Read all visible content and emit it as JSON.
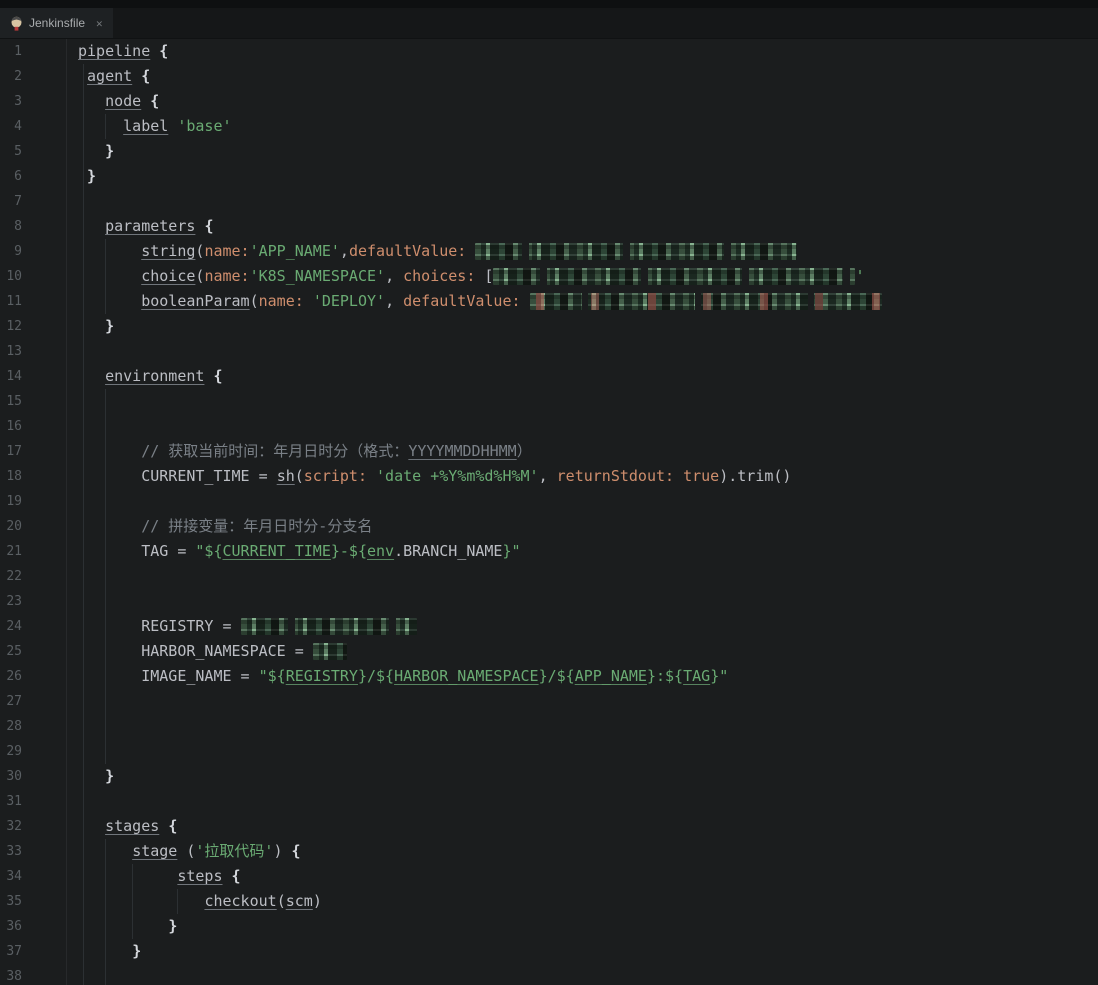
{
  "tab": {
    "title": "Jenkinsfile",
    "close": "✕",
    "icon": "jenkins-icon"
  },
  "theme": {
    "background": "#1b1d1e",
    "string_green": "#6aab73",
    "named_arg_orange": "#cf8e6d",
    "comment_gray": "#7a8087",
    "default_text": "#bcbec4",
    "line_number": "#5a5f63"
  },
  "editor": {
    "language": "Jenkinsfile (Groovy pipeline)",
    "lines": [
      {
        "n": "1",
        "ind": 0,
        "t": [
          [
            "pipeline",
            "u"
          ],
          [
            " ",
            "d"
          ],
          [
            "{",
            "b"
          ]
        ]
      },
      {
        "n": "2",
        "ind": 1,
        "t": [
          [
            "agent",
            "u"
          ],
          [
            " ",
            "d"
          ],
          [
            "{",
            "b"
          ]
        ]
      },
      {
        "n": "3",
        "ind": 3,
        "t": [
          [
            "node",
            "u"
          ],
          [
            " ",
            "d"
          ],
          [
            "{",
            "b"
          ]
        ]
      },
      {
        "n": "4",
        "ind": 5,
        "t": [
          [
            "label",
            "u"
          ],
          [
            " ",
            "d"
          ],
          [
            "'base'",
            "s"
          ]
        ]
      },
      {
        "n": "5",
        "ind": 3,
        "t": [
          [
            "}",
            "b"
          ]
        ]
      },
      {
        "n": "6",
        "ind": 1,
        "t": [
          [
            "}",
            "b"
          ]
        ]
      },
      {
        "n": "7",
        "ind": 0,
        "t": []
      },
      {
        "n": "8",
        "ind": 3,
        "t": [
          [
            "parameters",
            "u"
          ],
          [
            " ",
            "d"
          ],
          [
            "{",
            "b"
          ]
        ]
      },
      {
        "n": "9",
        "ind": 7,
        "t": [
          [
            "string",
            "u"
          ],
          [
            "(",
            "d"
          ],
          [
            "name:",
            "o"
          ],
          [
            "'APP_NAME'",
            "s"
          ],
          [
            ",",
            "d"
          ],
          [
            "defaultValue:",
            "o"
          ],
          [
            " ",
            "d"
          ],
          [
            "",
            "r",
            322
          ]
        ]
      },
      {
        "n": "10",
        "ind": 7,
        "t": [
          [
            "choice",
            "u"
          ],
          [
            "(",
            "d"
          ],
          [
            "name:",
            "o"
          ],
          [
            "'K8S_NAMESPACE'",
            "s"
          ],
          [
            ", ",
            "d"
          ],
          [
            "choices:",
            "o"
          ],
          [
            " [",
            "d"
          ],
          [
            "",
            "r",
            362
          ],
          [
            "'",
            "s"
          ]
        ]
      },
      {
        "n": "11",
        "ind": 7,
        "t": [
          [
            "booleanParam",
            "u"
          ],
          [
            "(",
            "d"
          ],
          [
            "name:",
            "o"
          ],
          [
            " ",
            "d"
          ],
          [
            "'DEPLOY'",
            "s"
          ],
          [
            ", ",
            "d"
          ],
          [
            "defaultValue:",
            "o"
          ],
          [
            " ",
            "d"
          ],
          [
            "",
            "r2",
            352
          ]
        ]
      },
      {
        "n": "12",
        "ind": 3,
        "t": [
          [
            "}",
            "b"
          ]
        ]
      },
      {
        "n": "13",
        "ind": 0,
        "t": []
      },
      {
        "n": "14",
        "ind": 3,
        "t": [
          [
            "environment",
            "u"
          ],
          [
            " ",
            "d"
          ],
          [
            "{",
            "b"
          ]
        ]
      },
      {
        "n": "15",
        "ind": 0,
        "t": []
      },
      {
        "n": "16",
        "ind": 0,
        "t": []
      },
      {
        "n": "17",
        "ind": 7,
        "t": [
          [
            "// 获取当前时间：年月日时分（格式：",
            "c"
          ],
          [
            "YYYYMMDDHHMM",
            "cu"
          ],
          [
            "）",
            "c"
          ]
        ]
      },
      {
        "n": "18",
        "ind": 7,
        "t": [
          [
            "CURRENT_TIME = ",
            "d"
          ],
          [
            "sh",
            "u"
          ],
          [
            "(",
            "d"
          ],
          [
            "script:",
            "o"
          ],
          [
            " ",
            "d"
          ],
          [
            "'date +%Y%m%d%H%M'",
            "s"
          ],
          [
            ", ",
            "d"
          ],
          [
            "returnStdout:",
            "o"
          ],
          [
            " ",
            "d"
          ],
          [
            "true",
            "o"
          ],
          [
            ").trim()",
            "d"
          ]
        ]
      },
      {
        "n": "19",
        "ind": 0,
        "t": []
      },
      {
        "n": "20",
        "ind": 7,
        "t": [
          [
            "// 拼接变量：年月日时分-分支名",
            "c"
          ]
        ]
      },
      {
        "n": "21",
        "ind": 7,
        "t": [
          [
            "TAG = ",
            "d"
          ],
          [
            "\"${",
            "s"
          ],
          [
            "CURRENT_TIME",
            "su"
          ],
          [
            "}-${",
            "s"
          ],
          [
            "env",
            "su"
          ],
          [
            ".BRANCH_NAME",
            "d"
          ],
          [
            "}\"",
            "s"
          ]
        ]
      },
      {
        "n": "22",
        "ind": 0,
        "t": []
      },
      {
        "n": "23",
        "ind": 0,
        "t": []
      },
      {
        "n": "24",
        "ind": 7,
        "t": [
          [
            "REGISTRY = ",
            "d"
          ],
          [
            "",
            "r",
            176
          ]
        ]
      },
      {
        "n": "25",
        "ind": 7,
        "t": [
          [
            "HARBOR_NAMESPACE = ",
            "d"
          ],
          [
            "",
            "r",
            34
          ]
        ]
      },
      {
        "n": "26",
        "ind": 7,
        "t": [
          [
            "IMAGE_NAME = ",
            "d"
          ],
          [
            "\"${",
            "s"
          ],
          [
            "REGISTRY",
            "su"
          ],
          [
            "}/${",
            "s"
          ],
          [
            "HARBOR_NAMESPACE",
            "su"
          ],
          [
            "}/${",
            "s"
          ],
          [
            "APP_NAME",
            "su"
          ],
          [
            "}:${",
            "s"
          ],
          [
            "TAG",
            "su"
          ],
          [
            "}\"",
            "s"
          ]
        ]
      },
      {
        "n": "27",
        "ind": 0,
        "t": []
      },
      {
        "n": "28",
        "ind": 0,
        "t": []
      },
      {
        "n": "29",
        "ind": 0,
        "t": []
      },
      {
        "n": "30",
        "ind": 3,
        "t": [
          [
            "}",
            "b"
          ]
        ]
      },
      {
        "n": "31",
        "ind": 0,
        "t": []
      },
      {
        "n": "32",
        "ind": 3,
        "t": [
          [
            "stages",
            "u"
          ],
          [
            " ",
            "d"
          ],
          [
            "{",
            "b"
          ]
        ]
      },
      {
        "n": "33",
        "ind": 6,
        "t": [
          [
            "stage",
            "u"
          ],
          [
            " (",
            "d"
          ],
          [
            "'拉取代码'",
            "s"
          ],
          [
            ") ",
            "d"
          ],
          [
            "{",
            "b"
          ]
        ]
      },
      {
        "n": "34",
        "ind": 11,
        "t": [
          [
            "steps",
            "u"
          ],
          [
            " ",
            "d"
          ],
          [
            "{",
            "b"
          ]
        ]
      },
      {
        "n": "35",
        "ind": 14,
        "t": [
          [
            "checkout",
            "u"
          ],
          [
            "(",
            "d"
          ],
          [
            "scm",
            "u"
          ],
          [
            ")",
            "d"
          ]
        ]
      },
      {
        "n": "36",
        "ind": 10,
        "t": [
          [
            "}",
            "b"
          ]
        ]
      },
      {
        "n": "37",
        "ind": 6,
        "t": [
          [
            "}",
            "b"
          ]
        ]
      },
      {
        "n": "38",
        "ind": 0,
        "t": []
      }
    ]
  }
}
